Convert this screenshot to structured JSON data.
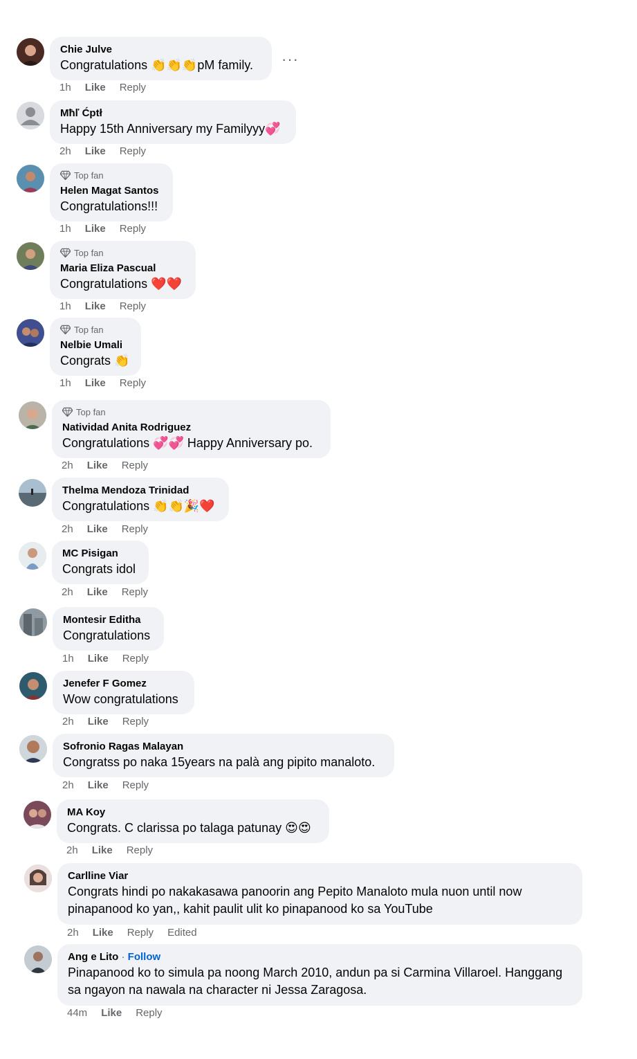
{
  "labels": {
    "like": "Like",
    "reply": "Reply",
    "top_fan": "Top fan",
    "edited": "Edited",
    "follow": "Follow",
    "more": "···"
  },
  "comments": [
    {
      "name": "Chie Julve",
      "text": "Congratulations 👏👏👏pM family.",
      "time": "1h",
      "top_fan": false
    },
    {
      "name": "Mħľ Ćptł",
      "text": "Happy 15th Anniversary my Familyyy💞",
      "time": "2h",
      "top_fan": false
    },
    {
      "name": "Helen Magat Santos",
      "text": "Congratulations!!!",
      "time": "1h",
      "top_fan": true
    },
    {
      "name": "Maria Eliza Pascual",
      "text": "Congratulations ❤️❤️",
      "time": "1h",
      "top_fan": true
    },
    {
      "name": "Nelbie Umali",
      "text": "Congrats 👏",
      "time": "1h",
      "top_fan": true
    },
    {
      "name": "Natividad Anita Rodriguez",
      "text": "Congratulations 💞💞 Happy Anniversary po.",
      "time": "2h",
      "top_fan": true
    },
    {
      "name": "Thelma Mendoza Trinidad",
      "text": "Congratulations 👏👏🎉❤️",
      "time": "2h",
      "top_fan": false
    },
    {
      "name": "MC Pisigan",
      "text": "Congrats idol",
      "time": "2h",
      "top_fan": false
    },
    {
      "name": "Montesir Editha",
      "text": "Congratulations",
      "time": "1h",
      "top_fan": false
    },
    {
      "name": "Jenefer F Gomez",
      "text": "Wow congratulations",
      "time": "2h",
      "top_fan": false
    },
    {
      "name": "Sofronio Ragas Malayan",
      "text": "Congratss po naka 15years na palà ang pipito manaloto.",
      "time": "2h",
      "top_fan": false
    },
    {
      "name": "MA Koy",
      "text": "Congrats. C clarissa po talaga patunay 😍😍",
      "time": "2h",
      "top_fan": false
    },
    {
      "name": "Carlline Viar",
      "text": "Congrats hindi po nakakasawa panoorin ang Pepito Manaloto mula nuon until now pinapanood ko yan,, kahit paulit ulit ko pinapanood ko sa YouTube",
      "time": "2h",
      "top_fan": false,
      "edited": true
    },
    {
      "name": "Ang e Lito",
      "text": "Pinapanood ko to simula pa noong March 2010, andun pa si Carmina Villaroel. Hanggang sa ngayon na nawala na character ni Jessa Zaragosa.",
      "time": "44m",
      "top_fan": false,
      "follow": true
    }
  ],
  "colors": {
    "bubble": "#f0f2f5",
    "meta": "#65676b",
    "link": "#0064d1"
  }
}
